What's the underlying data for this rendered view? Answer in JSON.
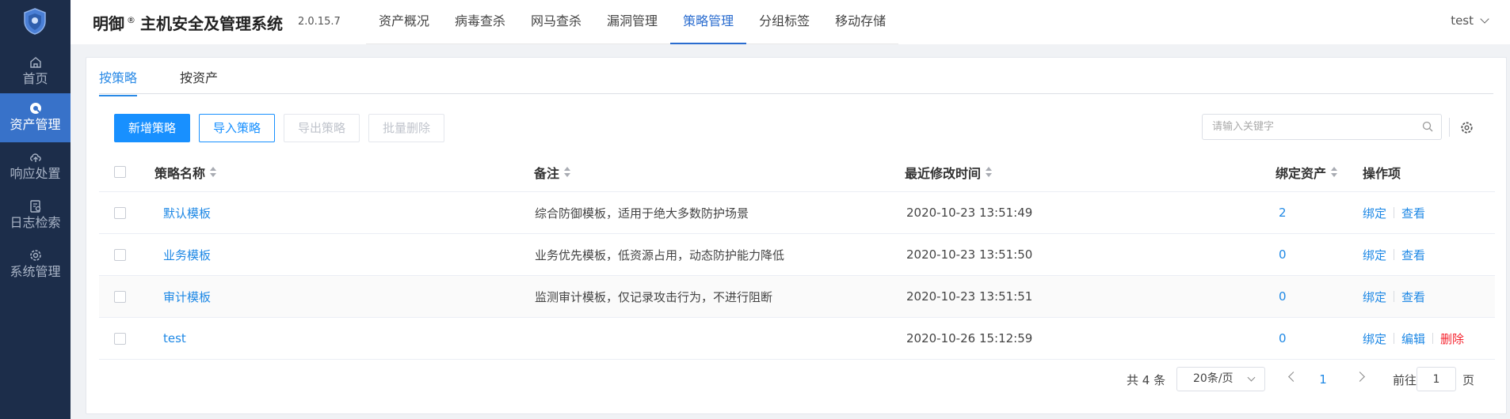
{
  "sidebar": {
    "items": [
      {
        "label": "首页",
        "icon": "home-icon",
        "active": false
      },
      {
        "label": "资产管理",
        "icon": "asset-icon",
        "active": true
      },
      {
        "label": "响应处置",
        "icon": "cloud-upload-icon",
        "active": false
      },
      {
        "label": "日志检索",
        "icon": "log-search-icon",
        "active": false
      },
      {
        "label": "系统管理",
        "icon": "settings-icon",
        "active": false
      }
    ]
  },
  "header": {
    "brand_name": "明御",
    "brand_mark": "®",
    "system_title": "主机安全及管理系统",
    "version": "2.0.15.7",
    "nav": [
      "资产概况",
      "病毒查杀",
      "网马查杀",
      "漏洞管理",
      "策略管理",
      "分组标签",
      "移动存储"
    ],
    "nav_active": "策略管理",
    "user": "test"
  },
  "tabs": [
    "按策略",
    "按资产"
  ],
  "tabs_active": "按策略",
  "toolbar": {
    "add_label": "新增策略",
    "import_label": "导入策略",
    "export_label": "导出策略",
    "batch_delete_label": "批量删除",
    "search_placeholder": "请输入关键字"
  },
  "table": {
    "headers": {
      "name": "策略名称",
      "remark": "备注",
      "modified": "最近修改时间",
      "bound": "绑定资产",
      "ops": "操作项"
    },
    "rows": [
      {
        "name": "默认模板",
        "remark": "综合防御模板，适用于绝大多数防护场景",
        "modified": "2020-10-23 13:51:49",
        "bound": "2",
        "ops": [
          "绑定",
          "查看"
        ]
      },
      {
        "name": "业务模板",
        "remark": "业务优先模板，低资源占用，动态防护能力降低",
        "modified": "2020-10-23 13:51:50",
        "bound": "0",
        "ops": [
          "绑定",
          "查看"
        ]
      },
      {
        "name": "审计模板",
        "remark": "监测审计模板，仅记录攻击行为，不进行阻断",
        "modified": "2020-10-23 13:51:51",
        "bound": "0",
        "ops": [
          "绑定",
          "查看"
        ]
      },
      {
        "name": "test",
        "remark": "",
        "modified": "2020-10-26 15:12:59",
        "bound": "0",
        "ops": [
          "绑定",
          "编辑",
          "删除"
        ]
      }
    ]
  },
  "pagination": {
    "total_text": "共 4 条",
    "page_size": "20条/页",
    "current_page": "1",
    "goto_prefix": "前往",
    "goto_value": "1",
    "goto_suffix": "页"
  },
  "colors": {
    "sidebar_bg": "#1c2d4a",
    "sidebar_active": "#3872c9",
    "primary": "#1890ff",
    "link": "#1e88e5",
    "danger": "#f5222d"
  }
}
